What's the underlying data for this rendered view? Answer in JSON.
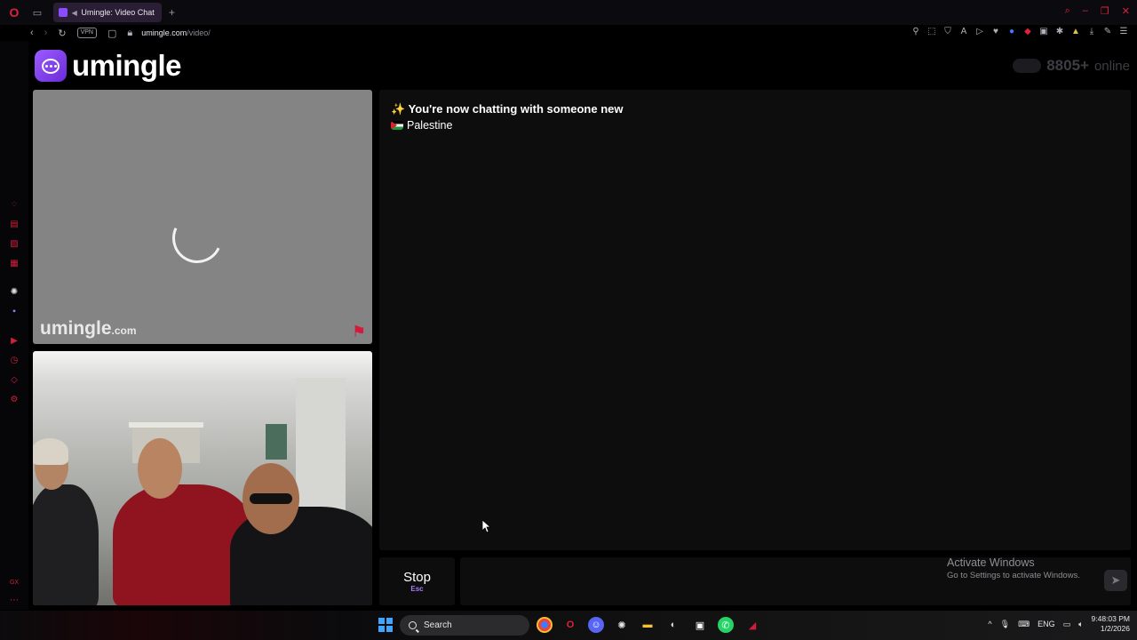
{
  "browser": {
    "tab_title": "Umingle: Video Chat w",
    "url_host": "umingle.com",
    "url_path": "/video/",
    "vpn_label": "VPN"
  },
  "site": {
    "logo_text": "umingle",
    "online_count": "8805+",
    "online_label": "online",
    "watermark": "umingle",
    "watermark_tld": ".com"
  },
  "chat": {
    "status_message": "✨ You're now chatting with someone new",
    "country": "Palestine",
    "input_value": "",
    "stop_label": "Stop",
    "stop_shortcut": "Esc"
  },
  "overlay": {
    "activate_title": "Activate Windows",
    "activate_sub": "Go to Settings to activate Windows."
  },
  "taskbar": {
    "search_label": "Search",
    "language": "ENG",
    "time": "9:48:03 PM",
    "date": "1/2/2026"
  },
  "colors": {
    "accent": "#8c4bff",
    "opera_red": "#e0213d",
    "panel": "#0d0d0e"
  }
}
